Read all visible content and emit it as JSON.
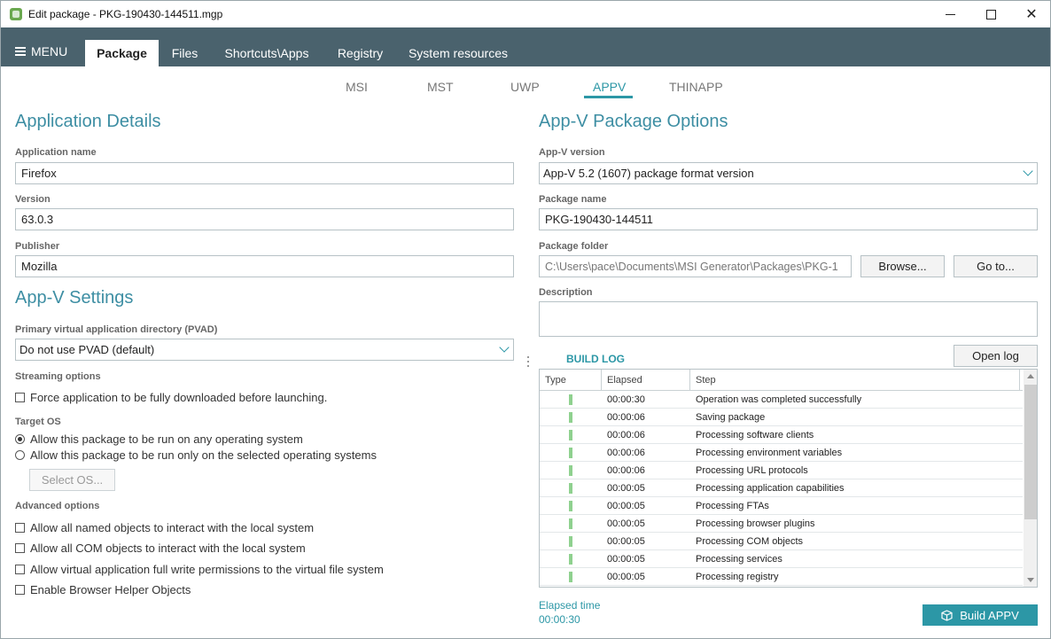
{
  "window": {
    "title": "Edit package - PKG-190430-144511.mgp"
  },
  "nav": {
    "menu_label": "MENU",
    "tabs": [
      {
        "label": "Package"
      },
      {
        "label": "Files"
      },
      {
        "label": "Shortcuts\\Apps"
      },
      {
        "label": "Registry"
      },
      {
        "label": "System resources"
      }
    ]
  },
  "subtabs": [
    {
      "label": "MSI"
    },
    {
      "label": "MST"
    },
    {
      "label": "UWP"
    },
    {
      "label": "APPV"
    },
    {
      "label": "THINAPP"
    }
  ],
  "app_details": {
    "title": "Application Details",
    "name_label": "Application name",
    "name_value": "Firefox",
    "version_label": "Version",
    "version_value": "63.0.3",
    "publisher_label": "Publisher",
    "publisher_value": "Mozilla"
  },
  "appv_settings": {
    "title": "App-V Settings",
    "pvad_label": "Primary virtual application directory (PVAD)",
    "pvad_value": "Do not use PVAD (default)",
    "streaming_label": "Streaming options",
    "streaming_force": "Force application to be fully downloaded before launching.",
    "target_os_label": "Target OS",
    "os_any": "Allow this package to be run on any operating system",
    "os_selected": "Allow this package to be run only on the selected operating systems",
    "select_os_button": "Select OS...",
    "advanced_label": "Advanced options",
    "adv_named": "Allow all named objects to interact with the local system",
    "adv_com": "Allow all COM objects to interact with the local system",
    "adv_write": "Allow virtual application full write permissions to the virtual file system",
    "adv_bho": "Enable Browser Helper Objects"
  },
  "package_options": {
    "title": "App-V Package Options",
    "version_label": "App-V version",
    "version_value": "App-V 5.2 (1607) package format version",
    "package_name_label": "Package name",
    "package_name_value": "PKG-190430-144511",
    "folder_label": "Package folder",
    "folder_value": "C:\\Users\\pace\\Documents\\MSI Generator\\Packages\\PKG-1",
    "browse_button": "Browse...",
    "goto_button": "Go to...",
    "description_label": "Description",
    "description_value": ""
  },
  "build_log": {
    "title": "BUILD LOG",
    "open_log_button": "Open log",
    "columns": [
      "Type",
      "Elapsed",
      "Step"
    ],
    "rows": [
      {
        "elapsed": "00:00:30",
        "step": "Operation was completed successfully"
      },
      {
        "elapsed": "00:00:06",
        "step": "Saving package"
      },
      {
        "elapsed": "00:00:06",
        "step": "Processing software clients"
      },
      {
        "elapsed": "00:00:06",
        "step": "Processing environment variables"
      },
      {
        "elapsed": "00:00:06",
        "step": "Processing URL protocols"
      },
      {
        "elapsed": "00:00:05",
        "step": "Processing application capabilities"
      },
      {
        "elapsed": "00:00:05",
        "step": "Processing FTAs"
      },
      {
        "elapsed": "00:00:05",
        "step": "Processing browser plugins"
      },
      {
        "elapsed": "00:00:05",
        "step": "Processing COM objects"
      },
      {
        "elapsed": "00:00:05",
        "step": "Processing services"
      },
      {
        "elapsed": "00:00:05",
        "step": "Processing registry"
      }
    ]
  },
  "footer": {
    "elapsed_label": "Elapsed time",
    "elapsed_value": "00:00:30",
    "build_button": "Build APPV"
  },
  "colors": {
    "accent": "#2c97a6",
    "nav_bg": "#4a626d",
    "section_title": "#3d8ea3",
    "success_indicator": "#8fd18f"
  }
}
